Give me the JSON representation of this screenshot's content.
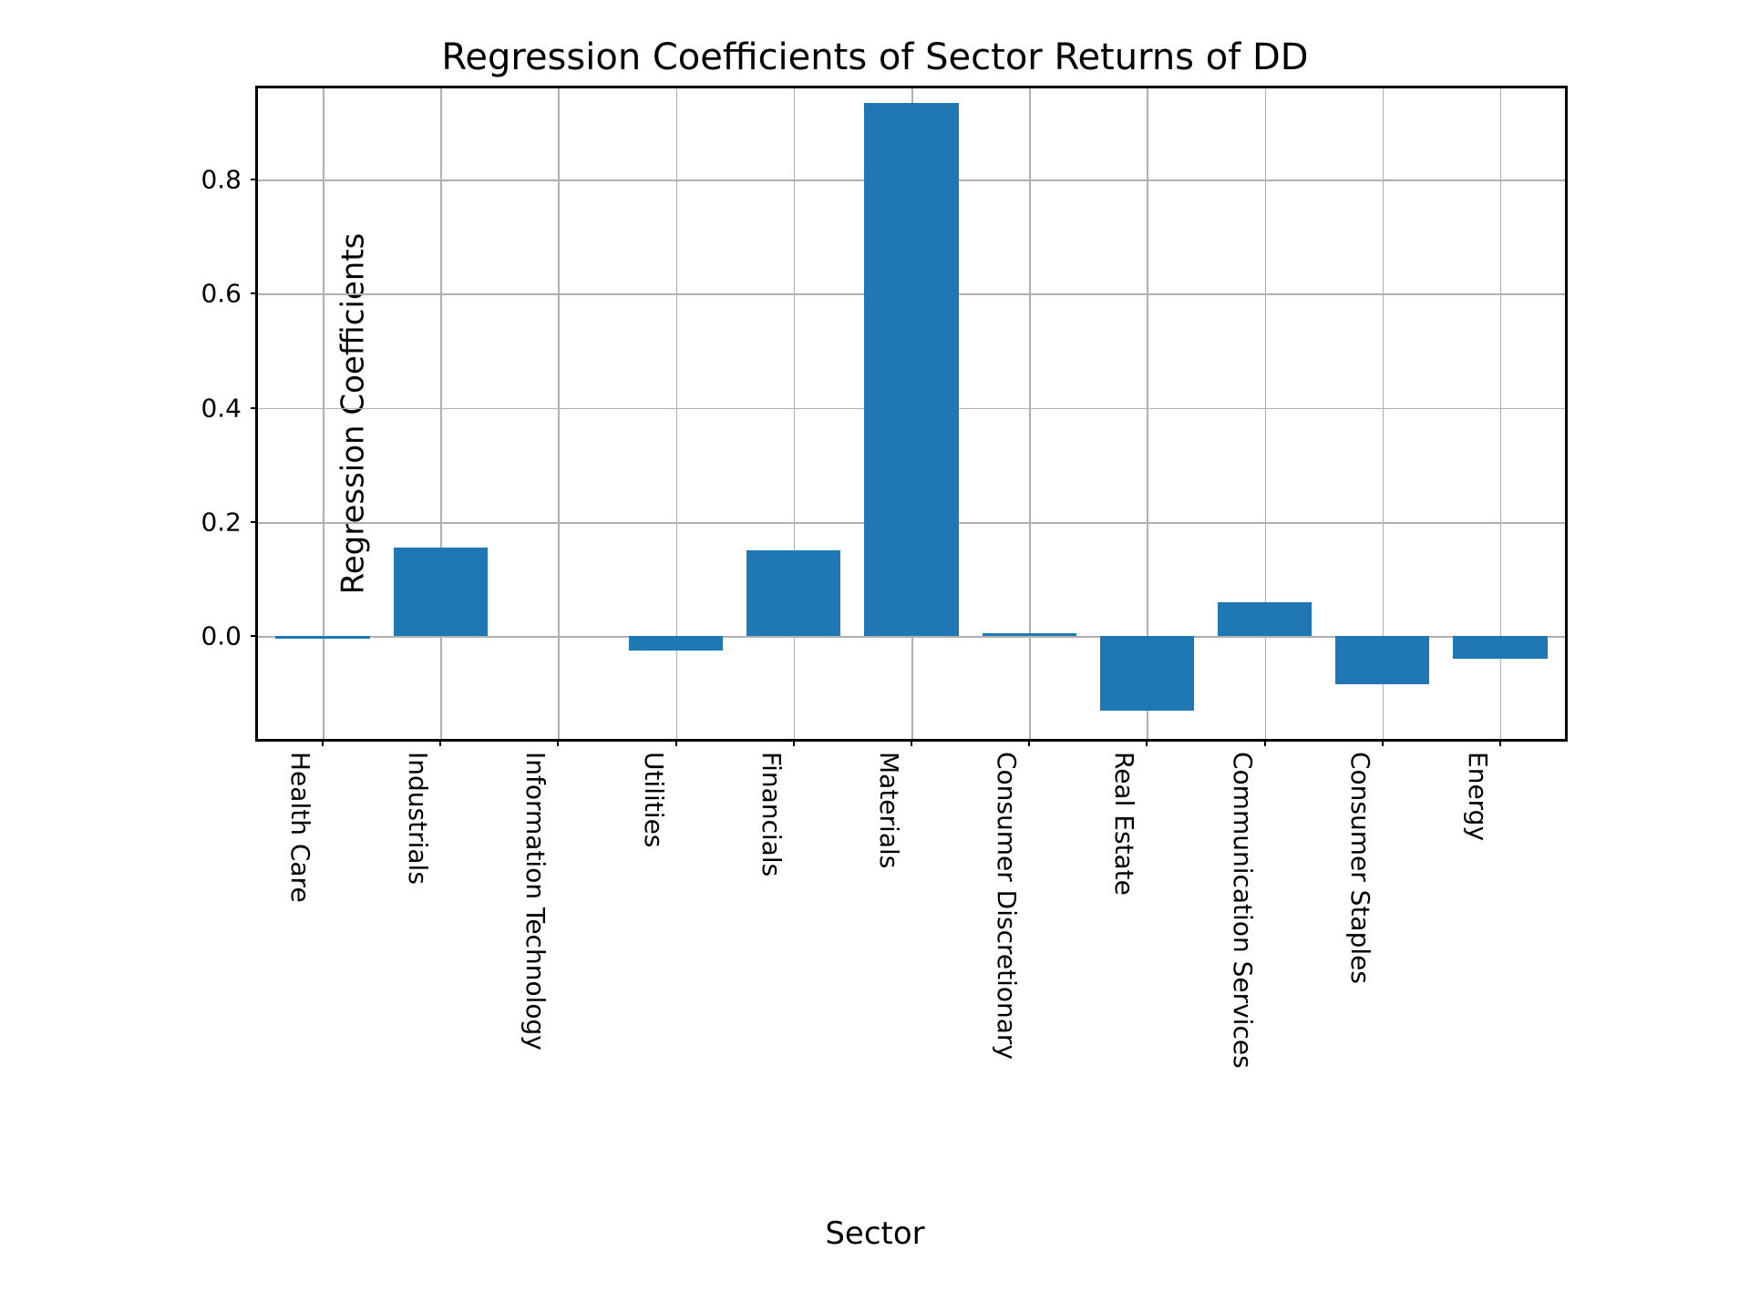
{
  "chart_data": {
    "type": "bar",
    "title": "Regression Coefficients of Sector Returns of DD",
    "xlabel": "Sector",
    "ylabel": "Regression Coefficients",
    "categories": [
      "Health Care",
      "Industrials",
      "Information Technology",
      "Utilities",
      "Financials",
      "Materials",
      "Consumer Discretionary",
      "Real Estate",
      "Communication Services",
      "Consumer Staples",
      "Energy"
    ],
    "values": [
      -0.005,
      0.155,
      0.0,
      -0.025,
      0.15,
      0.935,
      0.005,
      -0.13,
      0.06,
      -0.085,
      -0.04
    ],
    "ylim": [
      -0.18,
      0.96
    ],
    "yticks": [
      0.0,
      0.2,
      0.4,
      0.6,
      0.8
    ],
    "ytick_labels": [
      "0.0",
      "0.2",
      "0.4",
      "0.6",
      "0.8"
    ],
    "bar_color": "#1f77b4",
    "grid": true
  }
}
